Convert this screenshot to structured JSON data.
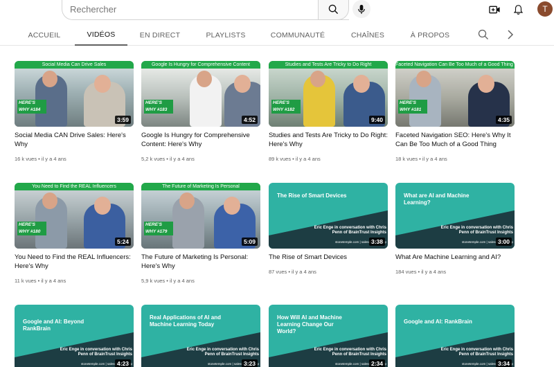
{
  "search": {
    "placeholder": "Rechercher"
  },
  "user": {
    "avatar_letter": "T"
  },
  "tabs": [
    {
      "label": "ACCUEIL"
    },
    {
      "label": "VIDÉOS"
    },
    {
      "label": "EN DIRECT"
    },
    {
      "label": "PLAYLISTS"
    },
    {
      "label": "COMMUNAUTÉ"
    },
    {
      "label": "CHAÎNES"
    },
    {
      "label": "À PROPOS"
    }
  ],
  "videos": [
    {
      "banner": "Social Media Can Drive Sales",
      "badge": "HERE'S WHY #184",
      "duration": "3:59",
      "title": "Social Media CAN Drive Sales: Here's Why",
      "meta": "16 k vues • il y a 4 ans"
    },
    {
      "banner": "Google Is Hungry for Comprehensive Content",
      "badge": "HERE'S WHY #183",
      "duration": "4:52",
      "title": "Google Is Hungry for Comprehensive Content: Here's Why",
      "meta": "5,2 k vues • il y a 4 ans"
    },
    {
      "banner": "Studies and Tests Are Tricky to Do Right",
      "badge": "HERE'S WHY #182",
      "duration": "9:40",
      "title": "Studies and Tests Are Tricky to Do Right: Here's Why",
      "meta": "89 k vues • il y a 4 ans"
    },
    {
      "banner": "Faceted Navigation Can Be Too Much of a Good Thing for SEO",
      "badge": "HERE'S WHY #181",
      "duration": "4:35",
      "title": "Faceted Navigation SEO: Here's Why It Can Be Too Much of a Good Thing",
      "meta": "18 k vues • il y a 4 ans"
    },
    {
      "banner": "You Need to Find the REAL Influencers",
      "badge": "HERE'S WHY #180",
      "duration": "5:24",
      "title": "You Need to Find the REAL Influencers: Here's Why",
      "meta": "11 k vues • il y a 4 ans"
    },
    {
      "banner": "The Future of Marketing Is Personal",
      "badge": "HERE'S WHY #179",
      "duration": "5:09",
      "title": "The Future of Marketing Is Personal: Here's Why",
      "meta": "5,9 k vues • il y a 4 ans"
    },
    {
      "thumb_title": "The Rise of Smart Devices",
      "thumb_sub": "Eric Enge in conversation with Chris Penn of BrainTrust Insights",
      "thumb_footer": "stonetemple.com | sales@stonetemp",
      "duration": "3:38",
      "title": "The Rise of Smart Devices",
      "meta": "87 vues • il y a 4 ans"
    },
    {
      "thumb_title": "What are AI and Machine Learning?",
      "thumb_sub": "Eric Enge in conversation with Chris Penn of BrainTrust Insights",
      "thumb_footer": "stonetemple.com | sales@stonetemp",
      "duration": "3:00",
      "title": "What Are Machine Learning and AI?",
      "meta": "184 vues • il y a 4 ans"
    },
    {
      "thumb_title": "Google and AI: Beyond RankBrain",
      "thumb_sub": "Eric Enge in conversation with Chris Penn of BrainTrust Insights",
      "thumb_footer": "stonetemple.com | sales@stonetemp",
      "duration": "4:23"
    },
    {
      "thumb_title": "Real Applications of AI and Machine Learning Today",
      "thumb_sub": "Eric Enge in conversation with Chris Penn of BrainTrust Insights",
      "thumb_footer": "stonetemple.com | sales@stonetemp",
      "duration": "3:23"
    },
    {
      "thumb_title": "How Will AI and Machine Learning Change Our World?",
      "thumb_sub": "Eric Enge in conversation with Chris Penn of BrainTrust Insights",
      "thumb_footer": "stonetemple.com | sales@stonetemp",
      "duration": "2:34"
    },
    {
      "thumb_title": "Google and AI: RankBrain",
      "thumb_sub": "Eric Enge in conversation with Chris Penn of BrainTrust Insights",
      "thumb_footer": "stonetemple.com | sales@stonetemp",
      "duration": "3:34"
    }
  ],
  "colors": {
    "accent_green": "#22a84a",
    "teal": "#2fb2a3",
    "teal_dark": "#1d3d43",
    "avatar": "#8a4b2e"
  },
  "icons": [
    "search-icon",
    "mic-icon",
    "create-video-icon",
    "bell-icon",
    "tab-search-icon",
    "chevron-right-icon"
  ]
}
